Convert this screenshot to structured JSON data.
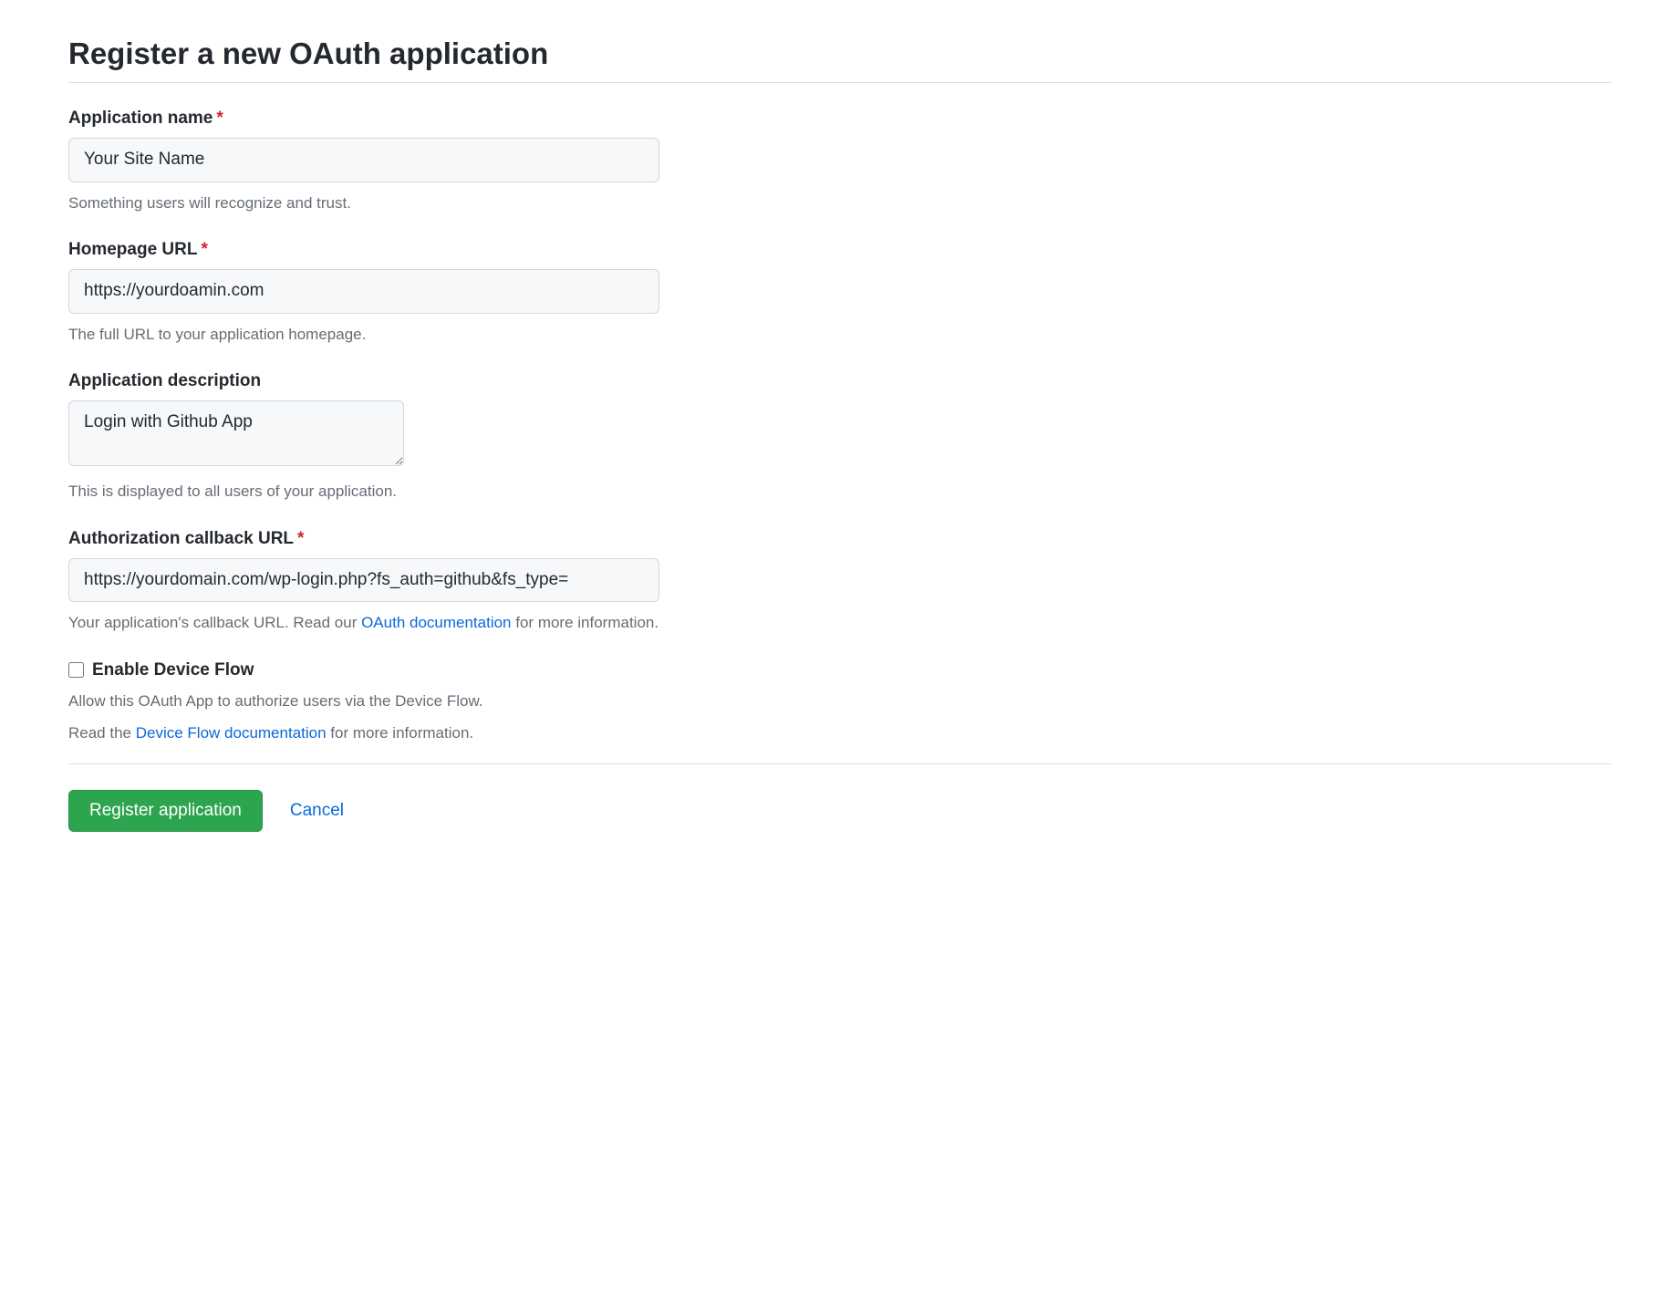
{
  "page_title": "Register a new OAuth application",
  "fields": {
    "app_name": {
      "label": "Application name",
      "required": true,
      "value": "Your Site Name",
      "hint": "Something users will recognize and trust."
    },
    "homepage_url": {
      "label": "Homepage URL",
      "required": true,
      "value": "https://yourdoamin.com",
      "hint": "The full URL to your application homepage."
    },
    "app_description": {
      "label": "Application description",
      "required": false,
      "value": "Login with Github App",
      "hint": "This is displayed to all users of your application."
    },
    "callback_url": {
      "label": "Authorization callback URL",
      "required": true,
      "value": "https://yourdomain.com/wp-login.php?fs_auth=github&fs_type=",
      "hint_before": "Your application's callback URL. Read our ",
      "hint_link": "OAuth documentation",
      "hint_after": " for more information."
    },
    "device_flow": {
      "label": "Enable Device Flow",
      "checked": false,
      "hint1": "Allow this OAuth App to authorize users via the Device Flow.",
      "hint2_before": "Read the ",
      "hint2_link": "Device Flow documentation",
      "hint2_after": " for more information."
    }
  },
  "buttons": {
    "submit": "Register application",
    "cancel": "Cancel"
  }
}
